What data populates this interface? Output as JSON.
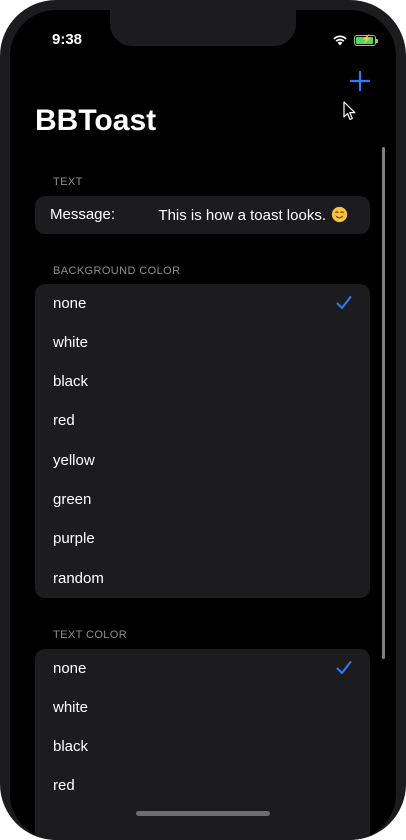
{
  "status_bar": {
    "time": "9:38"
  },
  "nav": {
    "title": "BBToast",
    "add_icon": "plus-icon"
  },
  "colors": {
    "accent": "#2f7bf6",
    "background": "#000000",
    "cell": "#1c1c1e",
    "section_header": "#8e8e93"
  },
  "sections": {
    "text": {
      "header": "TEXT",
      "message_label": "Message:",
      "message_value": "This is how a toast looks.",
      "message_emoji": "smiling-face-icon"
    },
    "background_color": {
      "header": "BACKGROUND COLOR",
      "selected": "none",
      "options": [
        "none",
        "white",
        "black",
        "red",
        "yellow",
        "green",
        "purple",
        "random"
      ]
    },
    "text_color": {
      "header": "TEXT COLOR",
      "selected": "none",
      "options": [
        "none",
        "white",
        "black",
        "red"
      ]
    }
  }
}
